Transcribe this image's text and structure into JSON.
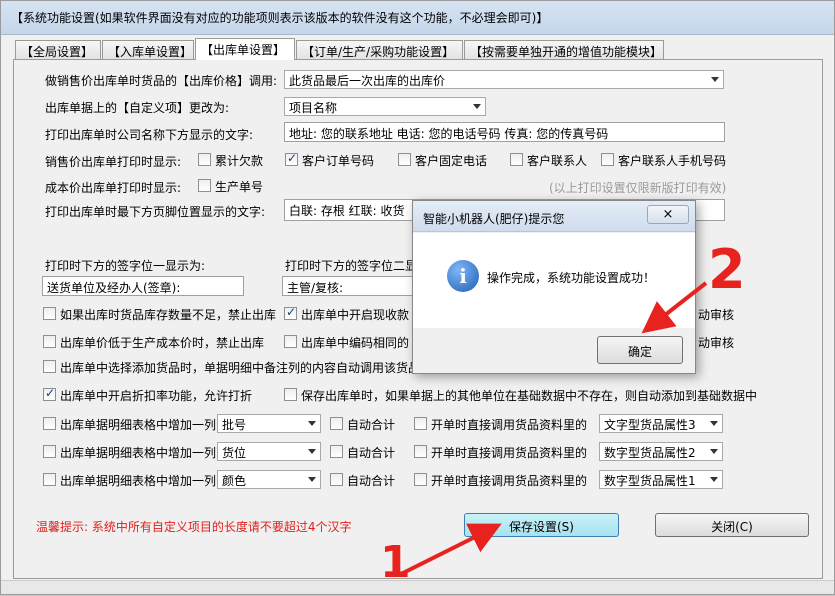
{
  "window": {
    "title": "【系统功能设置(如果软件界面没有对应的功能项则表示该版本的软件没有这个功能，不必理会即可)】"
  },
  "tabs": [
    "【全局设置】",
    "【入库单设置】",
    "【出库单设置】",
    "【订单/生产/采购功能设置】",
    "【按需要单独开通的增值功能模块】"
  ],
  "form": {
    "price_label": "做销售价出库单时货品的【出库价格】调用:",
    "price_value": "此货品最后一次出库的出库价",
    "custom_label": "出库单据上的【自定义项】更改为:",
    "custom_value": "项目名称",
    "company_label": "打印出库单时公司名称下方显示的文字:",
    "company_value": "地址: 您的联系地址 电话: 您的电话号码 传真: 您的传真号码",
    "sale_print_label": "销售价出库单打印时显示:",
    "sale_print_opts": [
      "累计欠款",
      "客户订单号码",
      "客户固定电话",
      "客户联系人",
      "客户联系人手机号码"
    ],
    "cost_print_label": "成本价出库单打印时显示:",
    "cost_print_opt": "生产单号",
    "print_note": "(以上打印设置仅限新版打印有效)",
    "footer_label": "打印出库单时最下方页脚位置显示的文字:",
    "footer_value": "白联: 存根  红联: 收货",
    "sign1_label": "打印时下方的签字位一显示为:",
    "sign1_value": "送货单位及经办人(签章):",
    "sign2_label": "打印时下方的签字位二显",
    "sign2_value": "主管/复核:"
  },
  "checks": {
    "c1": "如果出库时货品库存数量不足，禁止出库",
    "c2": "出库单中开启现收款",
    "c2_tail": "动审核",
    "c3": "出库单价低于生产成本价时，禁止出库",
    "c4": "出库单中编码相同的",
    "c4_tail": "动审核",
    "c5": "出库单中选择添加货品时，单据明细中备注列的内容自动调用该货品",
    "c6": "出库单中开启折扣率功能，允许打折",
    "c7": "保存出库单时，如果单据上的其他单位在基础数据中不存在，则自动添加到基础数据中"
  },
  "columns": {
    "add_label": "出库单据明细表格中增加一列",
    "auto_sum": "自动合计",
    "direct_call": "开单时直接调用货品资料里的",
    "rows": [
      {
        "field": "批号",
        "attr": "文字型货品属性3"
      },
      {
        "field": "货位",
        "attr": "数字型货品属性2"
      },
      {
        "field": "颜色",
        "attr": "数字型货品属性1"
      }
    ]
  },
  "hint": "温馨提示: 系统中所有自定义项目的长度请不要超过4个汉字",
  "buttons": {
    "save": "保存设置(S)",
    "close": "关闭(C)"
  },
  "dialog": {
    "title": "智能小机器人(肥仔)提示您",
    "message": "操作完成，系统功能设置成功！",
    "ok": "确定",
    "close_icon": "×"
  },
  "annotations": {
    "one": "1",
    "two": "2"
  }
}
